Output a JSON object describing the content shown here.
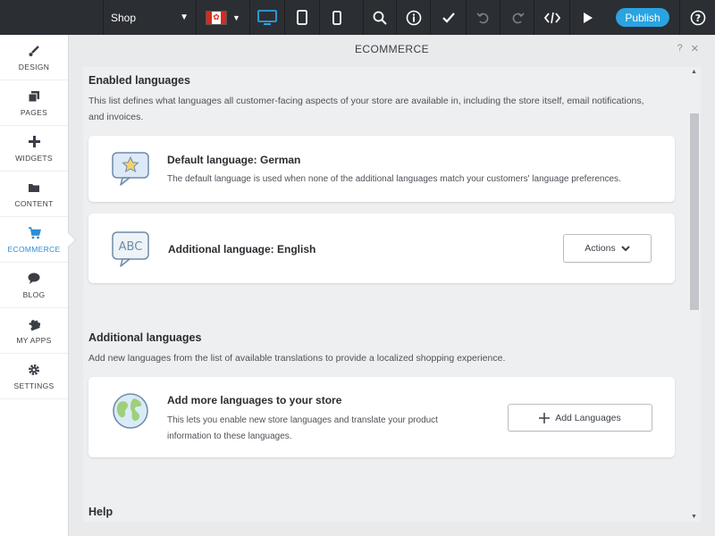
{
  "topbar": {
    "page_select": "Shop",
    "publish_label": "Publish"
  },
  "sidebar": {
    "items": [
      {
        "label": "DESIGN",
        "icon": "brush-icon"
      },
      {
        "label": "PAGES",
        "icon": "pages-icon"
      },
      {
        "label": "WIDGETS",
        "icon": "plus-icon"
      },
      {
        "label": "CONTENT",
        "icon": "folder-icon"
      },
      {
        "label": "ECOMMERCE",
        "icon": "cart-icon",
        "active": true
      },
      {
        "label": "BLOG",
        "icon": "speech-bubble-icon"
      },
      {
        "label": "MY APPS",
        "icon": "puzzle-icon"
      },
      {
        "label": "SETTINGS",
        "icon": "gear-icon"
      }
    ]
  },
  "panel": {
    "title": "ECOMMERCE",
    "help": "?",
    "close": "✕"
  },
  "enabled": {
    "title": "Enabled languages",
    "desc": "This list defines what languages all customer-facing aspects of your store are available in, including the store itself, email notifications, and invoices.",
    "default_card": {
      "title": "Default language: German",
      "desc": "The default language is used when none of the additional languages match your customers' language preferences."
    },
    "additional_card": {
      "title": "Additional language: English",
      "icon_text": "ABC",
      "actions_label": "Actions"
    }
  },
  "additional": {
    "title": "Additional languages",
    "desc": "Add new languages from the list of available translations to provide a localized shopping experience.",
    "card": {
      "title": "Add more languages to your store",
      "desc_line1": "This lets you enable new store languages and translate your product",
      "desc_line2": "information to these languages.",
      "button_label": "Add Languages"
    }
  },
  "help": {
    "title": "Help"
  },
  "colors": {
    "accent": "#2aa3e0",
    "topbar": "#2b2e33",
    "active_nav": "#2b8ed6"
  }
}
